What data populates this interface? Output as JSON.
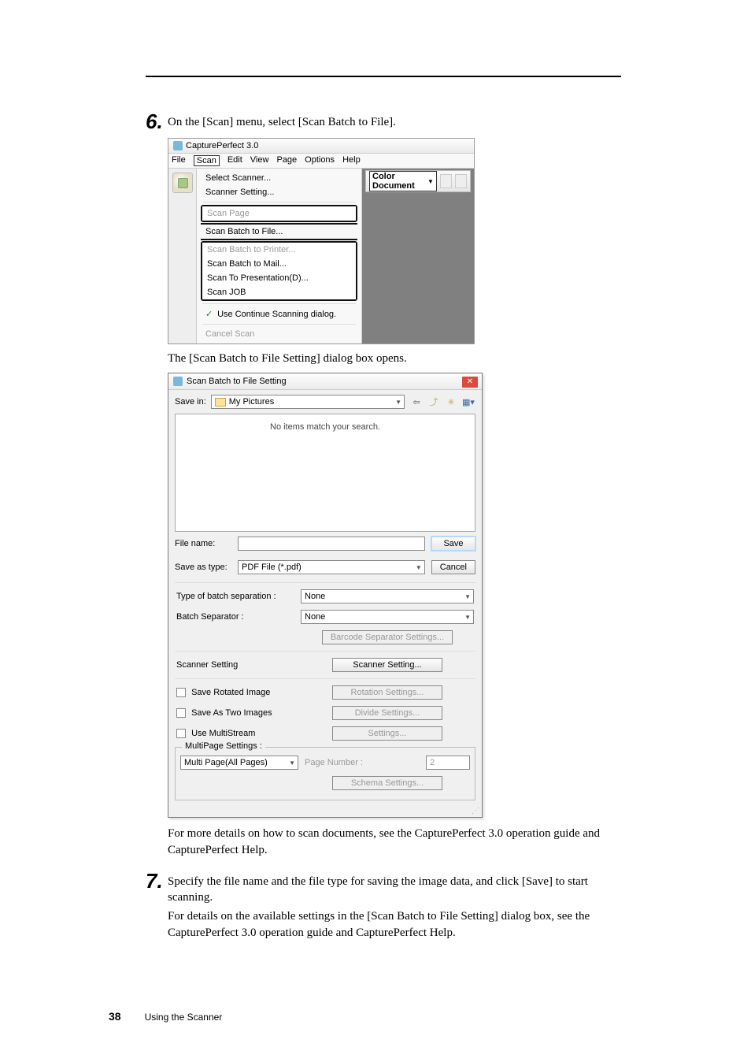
{
  "step6": {
    "num": "6",
    "text": "On the [Scan] menu, select [Scan Batch to File]."
  },
  "cp30": {
    "title": "CapturePerfect 3.0",
    "menubar": [
      "File",
      "Scan",
      "Edit",
      "View",
      "Page",
      "Options",
      "Help"
    ],
    "menu": {
      "select_scanner": "Select Scanner...",
      "scanner_setting": "Scanner Setting...",
      "scan_page": "Scan Page",
      "scan_batch_file": "Scan Batch to File...",
      "scan_batch_printer": "Scan Batch to Printer...",
      "scan_batch_mail": "Scan Batch to Mail...",
      "scan_presentation": "Scan To Presentation(D)...",
      "scan_job": "Scan JOB",
      "use_continue": "Use Continue Scanning dialog.",
      "cancel_scan": "Cancel Scan"
    },
    "toolbar_mode": "Color Document"
  },
  "after_cp30": "The [Scan Batch to File Setting] dialog box opens.",
  "dlg": {
    "title": "Scan Batch to File Setting",
    "save_in_label": "Save in:",
    "save_in_value": "My Pictures",
    "file_area_text": "No items match your search.",
    "file_name_label": "File name:",
    "file_name_value": "",
    "save_as_type_label": "Save as type:",
    "save_as_type_value": "PDF File (*.pdf)",
    "save_btn": "Save",
    "cancel_btn": "Cancel",
    "batch_type_label": "Type of batch separation :",
    "batch_type_value": "None",
    "batch_sep_label": "Batch Separator :",
    "batch_sep_value": "None",
    "barcode_btn": "Barcode Separator Settings...",
    "scanner_setting_label": "Scanner Setting",
    "scanner_setting_btn": "Scanner Setting...",
    "save_rotated_label": "Save Rotated Image",
    "rotation_btn": "Rotation Settings...",
    "save_two_label": "Save As Two Images",
    "divide_btn": "Divide Settings...",
    "use_multi_label": "Use MultiStream",
    "settings_btn": "Settings...",
    "multipage_legend": "MultiPage Settings :",
    "multipage_value": "Multi Page(All Pages)",
    "page_number_label": "Page Number :",
    "page_number_value": "2",
    "schema_btn": "Schema Settings..."
  },
  "after_dlg": "For more details on how to scan documents, see the CapturePerfect 3.0 operation guide and CapturePerfect Help.",
  "step7": {
    "num": "7",
    "text1": "Specify the file name and the file type for saving the image data, and click [Save] to start scanning.",
    "text2": "For details on the available settings in the [Scan Batch to File Setting] dialog box, see the CapturePerfect 3.0 operation guide and CapturePerfect Help."
  },
  "footer": {
    "page": "38",
    "section": "Using the Scanner"
  }
}
